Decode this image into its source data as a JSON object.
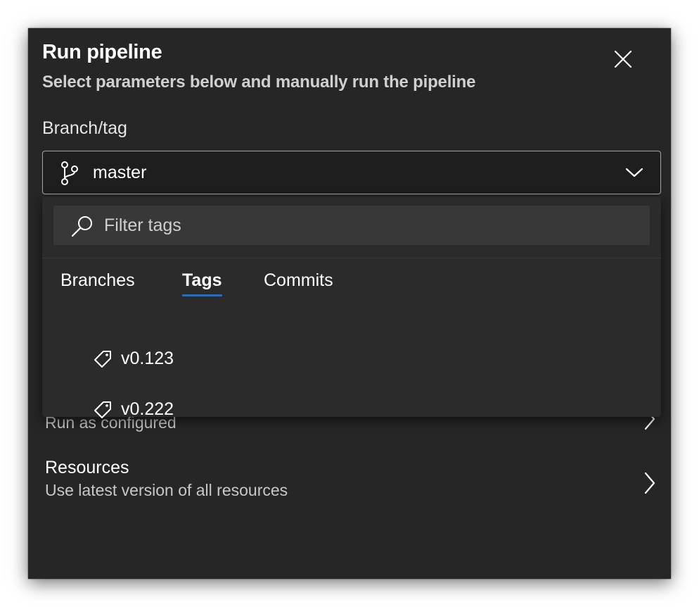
{
  "panel": {
    "title": "Run pipeline",
    "subtitle": "Select parameters below and manually run the pipeline"
  },
  "branch_tag": {
    "label": "Branch/tag",
    "selected": "master"
  },
  "dropdown": {
    "filter_placeholder": "Filter tags",
    "tabs": [
      {
        "label": "Branches",
        "active": false
      },
      {
        "label": "Tags",
        "active": true
      },
      {
        "label": "Commits",
        "active": false
      }
    ],
    "items": [
      {
        "label": "v0.123",
        "icon": "tag-icon"
      },
      {
        "label": "v0.222",
        "icon": "tag-icon"
      }
    ]
  },
  "sections": {
    "advanced_sub": "Run as configured",
    "resources_title": "Resources",
    "resources_sub": "Use latest version of all resources"
  },
  "colors": {
    "panel_bg": "#262626",
    "dropdown_bg": "#2b2b2b",
    "accent": "#1f6fd1"
  }
}
